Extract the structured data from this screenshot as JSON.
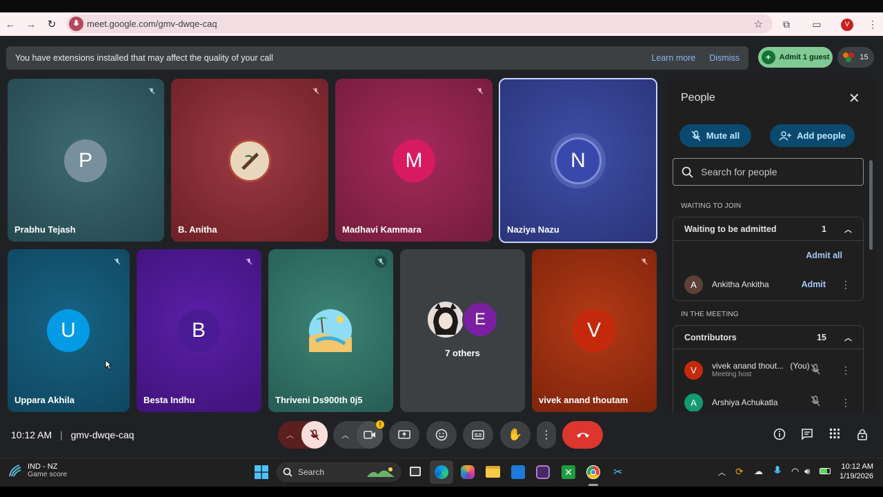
{
  "browser": {
    "url": "meet.google.com/gmv-dwqe-caq",
    "profile_initial": "V"
  },
  "notice": {
    "text": "You have extensions installed that may affect the quality of your call",
    "learn_more": "Learn more",
    "dismiss": "Dismiss"
  },
  "top_right": {
    "admit_label": "Admit 1 guest",
    "people_count": "15"
  },
  "tiles": [
    {
      "name": "Prabhu Tejash",
      "initial": "P"
    },
    {
      "name": "B. Anitha",
      "initial": ""
    },
    {
      "name": "Madhavi Kammara",
      "initial": "M"
    },
    {
      "name": "Naziya Nazu",
      "initial": "N"
    },
    {
      "name": "Uppara Akhila",
      "initial": "U"
    },
    {
      "name": "Besta Indhu",
      "initial": "B"
    },
    {
      "name": "Thriveni Ds900th 0j5",
      "initial": ""
    },
    {
      "name": "7 others",
      "initial": "E"
    },
    {
      "name": "vivek anand thoutam",
      "initial": "V"
    }
  ],
  "meeting": {
    "time": "10:12 AM",
    "code": "gmv-dwqe-caq"
  },
  "people_panel": {
    "title": "People",
    "mute_all": "Mute all",
    "add_people": "Add people",
    "search_placeholder": "Search for people",
    "waiting_section": "WAITING TO JOIN",
    "waiting_header": "Waiting to be admitted",
    "waiting_count": "1",
    "admit_all": "Admit all",
    "waiting_person": {
      "initial": "A",
      "name": "Ankitha Ankitha",
      "action": "Admit"
    },
    "meeting_section": "IN THE MEETING",
    "contributors_header": "Contributors",
    "contributors_count": "15",
    "contributors": [
      {
        "initial": "V",
        "name": "vivek anand thout...",
        "you": "(You)",
        "sub": "Meeting host"
      },
      {
        "initial": "A",
        "name": "Arshiya Achukatla",
        "you": "",
        "sub": ""
      }
    ]
  },
  "taskbar": {
    "weather_title": "IND - NZ",
    "weather_sub": "Game score",
    "search": "Search",
    "time": "10:12 AM",
    "date": "1/19/2026"
  }
}
